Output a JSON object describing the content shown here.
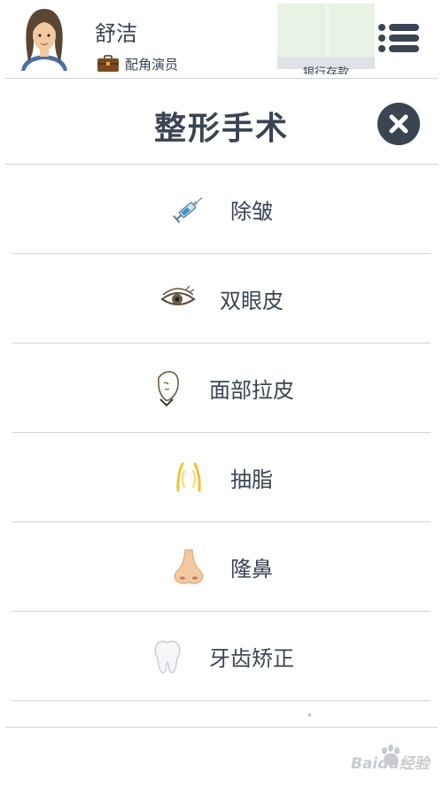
{
  "header": {
    "user_name": "舒洁",
    "role": "配角演员",
    "ad_text": "银行存款"
  },
  "page": {
    "title": "整形手术"
  },
  "menu": {
    "items": [
      {
        "label": "除皱",
        "icon": "syringe-icon"
      },
      {
        "label": "双眼皮",
        "icon": "eye-icon"
      },
      {
        "label": "面部拉皮",
        "icon": "face-outline-icon"
      },
      {
        "label": "抽脂",
        "icon": "liposuction-icon"
      },
      {
        "label": "隆鼻",
        "icon": "nose-icon"
      },
      {
        "label": "牙齿矫正",
        "icon": "tooth-icon"
      }
    ]
  },
  "watermark": {
    "text": "Baidu经验"
  },
  "colors": {
    "text": "#3a4453",
    "divider": "#cfd3d8",
    "close_bg": "#3a4453"
  }
}
